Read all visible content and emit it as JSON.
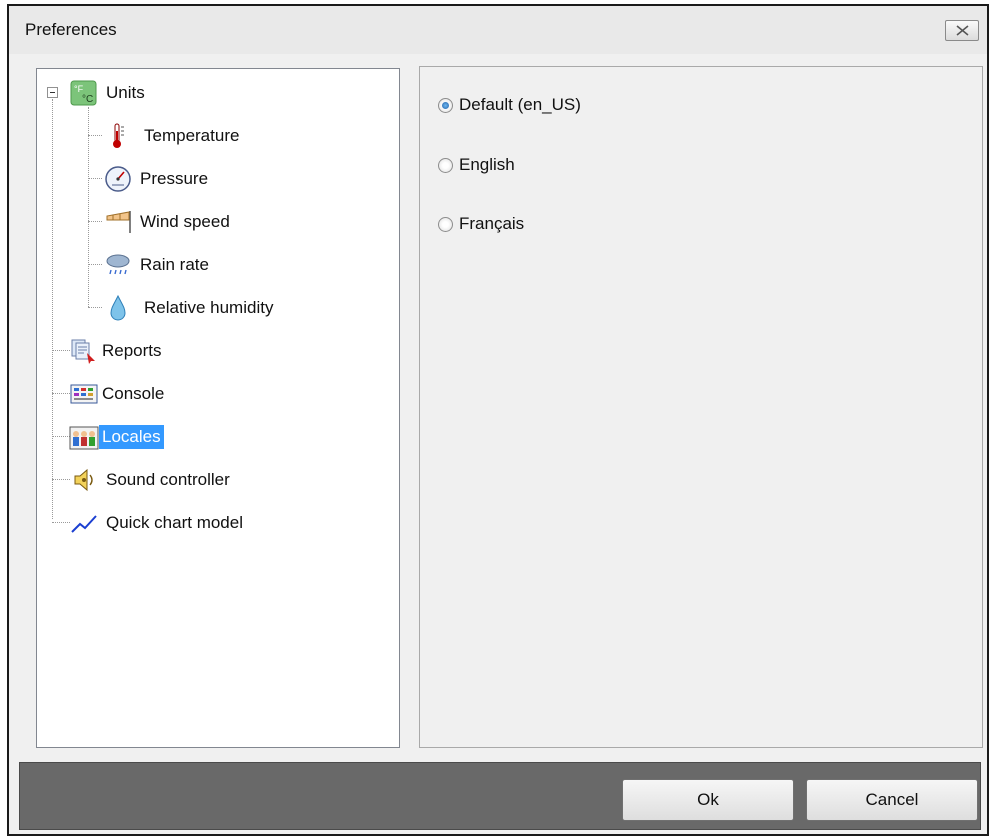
{
  "window": {
    "title": "Preferences"
  },
  "tree": {
    "items": [
      {
        "label": "Units",
        "icon": "temperature-units-icon"
      },
      {
        "label": "Temperature",
        "icon": "thermometer-icon"
      },
      {
        "label": "Pressure",
        "icon": "barometer-icon"
      },
      {
        "label": "Wind speed",
        "icon": "windsock-icon"
      },
      {
        "label": "Rain rate",
        "icon": "rain-cloud-icon"
      },
      {
        "label": "Relative humidity",
        "icon": "water-drop-icon"
      },
      {
        "label": "Reports",
        "icon": "reports-icon"
      },
      {
        "label": "Console",
        "icon": "console-icon"
      },
      {
        "label": "Locales",
        "icon": "locales-people-icon",
        "selected": true
      },
      {
        "label": "Sound controller",
        "icon": "speaker-icon"
      },
      {
        "label": "Quick chart model",
        "icon": "line-chart-icon"
      }
    ]
  },
  "locales": {
    "options": [
      {
        "label": "Default (en_US)",
        "checked": true
      },
      {
        "label": "English",
        "checked": false
      },
      {
        "label": "Français",
        "checked": false
      }
    ]
  },
  "buttons": {
    "ok": "Ok",
    "cancel": "Cancel"
  },
  "colors": {
    "selection": "#3399ff",
    "button_bar": "#696969"
  }
}
